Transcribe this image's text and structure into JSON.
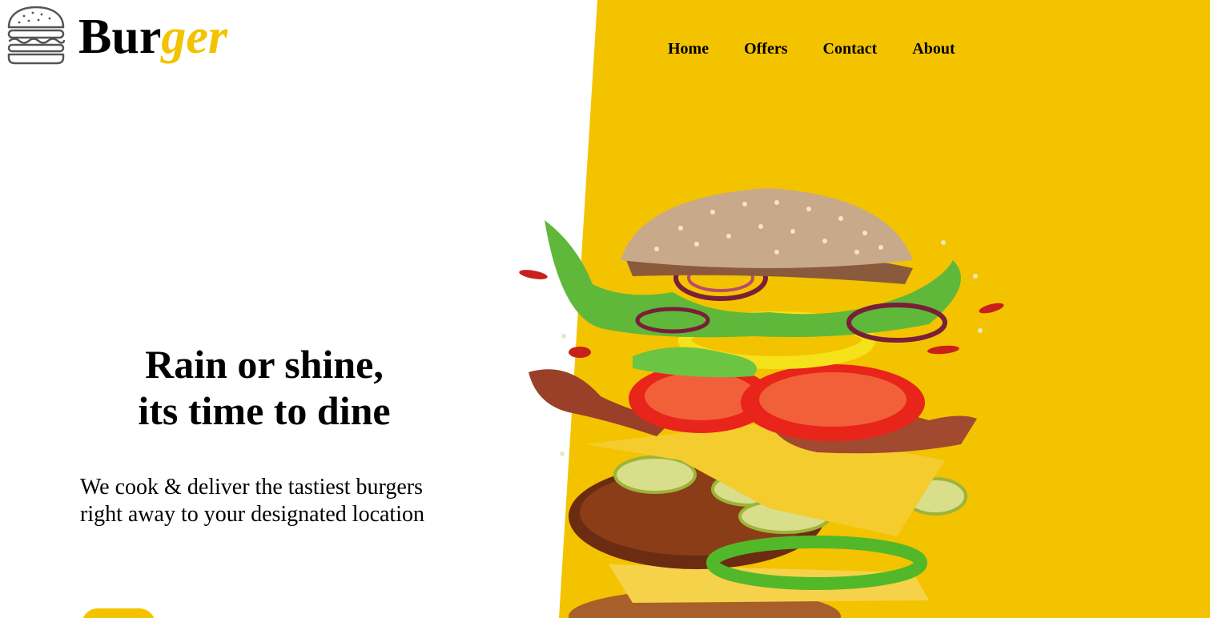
{
  "brand": {
    "prefix": "Bur",
    "accent": "ger"
  },
  "nav": {
    "items": [
      {
        "label": "Home"
      },
      {
        "label": "Offers"
      },
      {
        "label": "Contact"
      },
      {
        "label": "About"
      }
    ]
  },
  "hero": {
    "title_line1": "Rain or shine,",
    "title_line2": "its time to dine",
    "text_line1": "We cook & deliver the tastiest burgers",
    "text_line2": "right away to your designated location"
  },
  "icons": {
    "logo": "burger-outline-icon",
    "hero_image": "burger-photo"
  },
  "colors": {
    "accent": "#f3c300",
    "text": "#000000",
    "background": "#ffffff"
  }
}
